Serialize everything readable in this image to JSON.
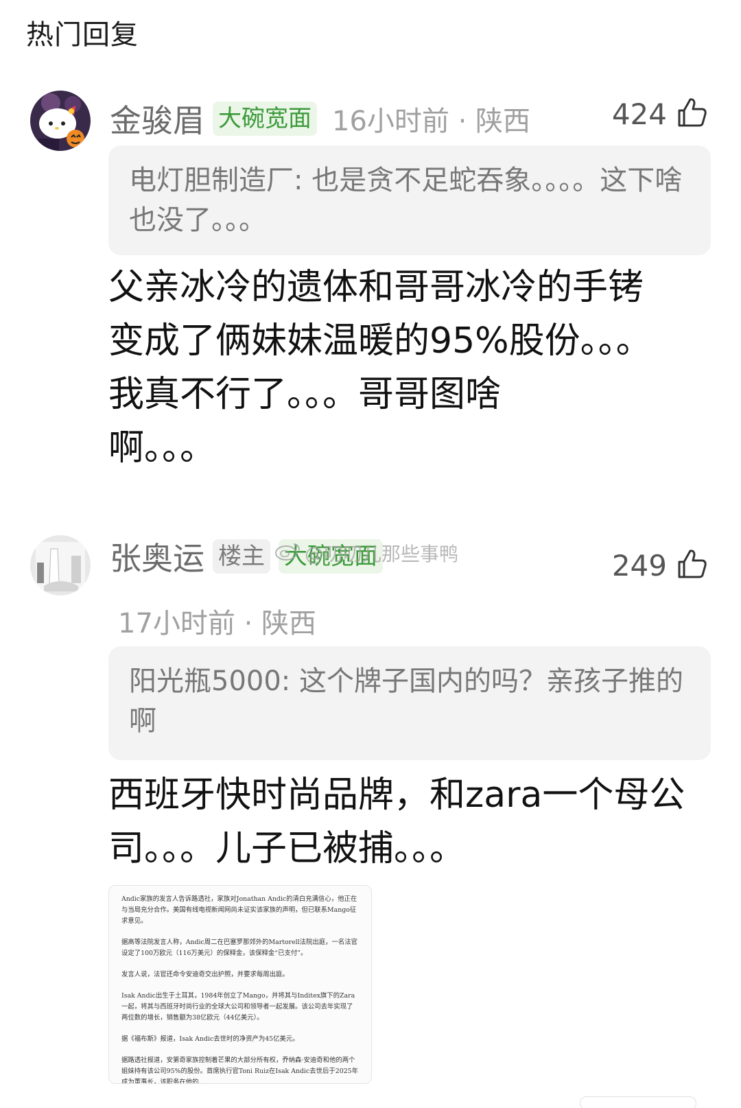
{
  "section_title": "热门回复",
  "comments": [
    {
      "username": "金骏眉",
      "tags": [
        "大碗宽面"
      ],
      "time_location": "16小时前 · 陕西",
      "likes": "424",
      "quote": {
        "author": "电灯胆制造厂",
        "text": "也是贪不足蛇吞象。。。。这下啥也没了。。。"
      },
      "body": [
        "父亲冰冷的遗体和哥哥冰冷的手铐",
        "变成了俩妹妹温暖的95%股份。。。",
        "我真不行了。。。哥哥图啥",
        "啊。。。"
      ]
    },
    {
      "username": "张奥运",
      "tags": [
        "楼主",
        "大碗宽面"
      ],
      "time_location": "17小时前 · 陕西",
      "likes": "249",
      "quote": {
        "author": "阳光瓶5000",
        "text": "这个牌子国内的吗？亲孩子推的啊"
      },
      "body": [
        "西班牙快时尚品牌，和zara一个母公",
        "司。。。儿子已被捕。。。"
      ],
      "image_paragraphs": [
        "Andic家族的发言人告诉路透社，家族对Jonathan Andic的清白充满信心，他正在与当局充分合作。美国有线电视新闻网尚未证实该家族的声明，但已联系Mango征求意见。",
        "据高等法院发言人称，Andic周二在巴塞罗那郊外的Martorell法院出庭，一名法官设定了100万欧元（116万美元）的保释金，该保释金“已支付”。",
        "发言人说，法官还命令安迪奇交出护照，并要求每周出庭。",
        "Isak Andic出生于土耳其，1984年创立了Mango，并将其与Inditex旗下的Zara一起，将其与西班牙时尚行业的全球大公司和领导者一起发展。该公司去年实现了两位数的增长，销售额为38亿欧元（44亿美元）。",
        "据《福布斯》报道，Isak Andic去世时的净资产为45亿美元。",
        "据路透社报道，安第奇家族控制着芒果的大部分所有权，乔纳森·安迪奇和他的两个姐妹持有该公司95%的股份。首席执行官Toni Ruiz在Isak Andic去世后于2025年成为董事长，该职务在他的..."
      ]
    }
  ],
  "watermark": "@叨叨儿那些事鸭",
  "colors": {
    "tag_green_bg": "#ecf6e8",
    "tag_green_text": "#3c9b3c",
    "quote_bg": "#f3f3f3",
    "meta_text": "#a0a0a0"
  }
}
